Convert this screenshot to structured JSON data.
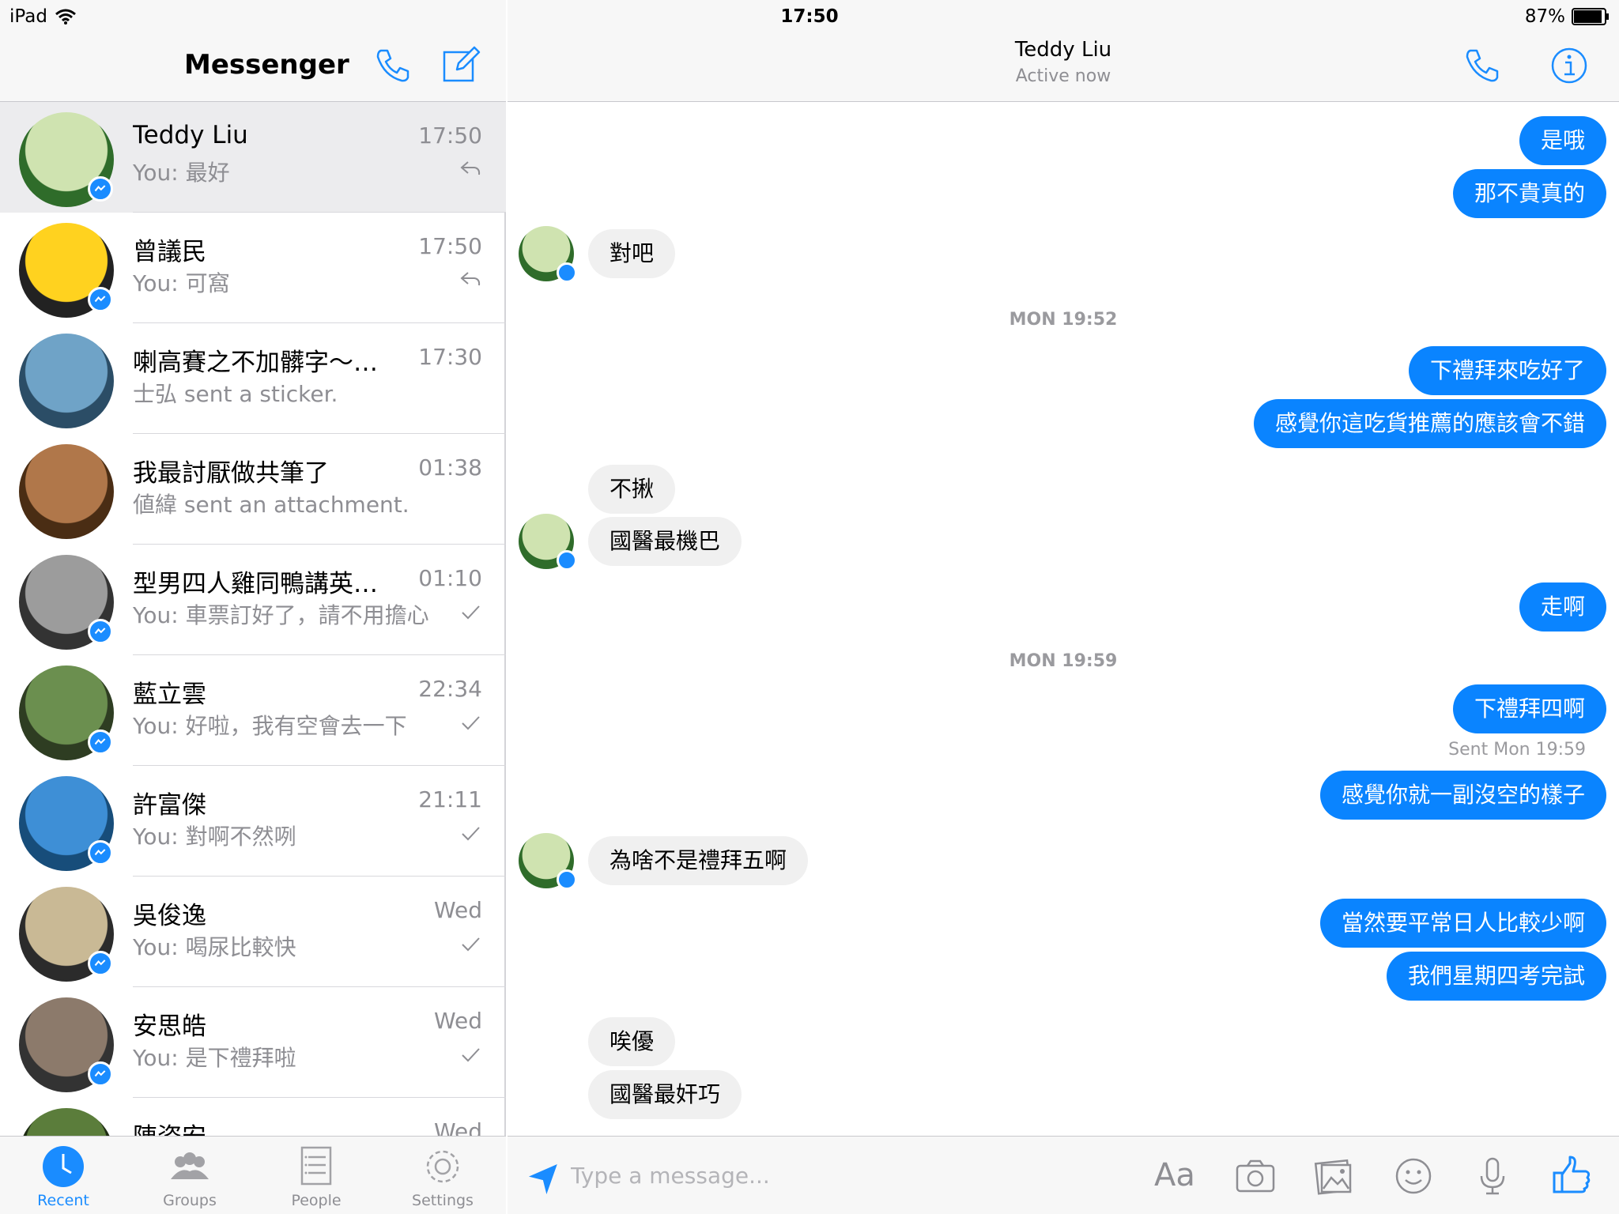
{
  "status_bar": {
    "device": "iPad",
    "time": "17:50",
    "battery": "87%"
  },
  "left_header": {
    "title": "Messenger"
  },
  "conversations": [
    {
      "name": "Teddy Liu",
      "time": "17:50",
      "preview": "You: 最好",
      "status": "reply"
    },
    {
      "name": "曾議民",
      "time": "17:50",
      "preview": "You: 可窩",
      "status": "reply"
    },
    {
      "name": "喇高賽之不加髒字～…",
      "time": "17:30",
      "preview": "士弘 sent a sticker.",
      "status": ""
    },
    {
      "name": "我最討厭做共筆了",
      "time": "01:38",
      "preview": "値緯 sent an attachment.",
      "status": ""
    },
    {
      "name": "型男四人雞同鴨講英…",
      "time": "01:10",
      "preview": "You: 車票訂好了，請不用擔心",
      "status": "check"
    },
    {
      "name": "藍立雲",
      "time": "22:34",
      "preview": "You: 好啦，我有空會去一下",
      "status": "check"
    },
    {
      "name": "許富傑",
      "time": "21:11",
      "preview": "You: 對啊不然咧",
      "status": "check"
    },
    {
      "name": "吳俊逸",
      "time": "Wed",
      "preview": "You: 喝尿比較快",
      "status": "check"
    },
    {
      "name": "安思皓",
      "time": "Wed",
      "preview": "You: 是下禮拜啦",
      "status": "check"
    },
    {
      "name": "陳姿安",
      "time": "Wed",
      "preview": "",
      "status": ""
    }
  ],
  "tabs": [
    {
      "label": "Recent",
      "icon": "clock-icon",
      "active": true
    },
    {
      "label": "Groups",
      "icon": "groups-icon",
      "active": false
    },
    {
      "label": "People",
      "icon": "people-list-icon",
      "active": false
    },
    {
      "label": "Settings",
      "icon": "gear-icon",
      "active": false
    }
  ],
  "chat_header": {
    "name": "Teddy Liu",
    "subtitle": "Active now"
  },
  "messages": [
    {
      "dir": "out",
      "text": "是哦"
    },
    {
      "dir": "out",
      "text": "那不貴真的"
    },
    {
      "dir": "in",
      "text": "對吧"
    },
    {
      "type": "stamp",
      "text": "MON 19:52"
    },
    {
      "dir": "out",
      "text": "下禮拜來吃好了"
    },
    {
      "dir": "out",
      "text": "感覺你這吃貨推薦的應該會不錯"
    },
    {
      "dir": "in",
      "text": "不揪"
    },
    {
      "dir": "in",
      "text": "國醫最機巴"
    },
    {
      "dir": "out",
      "text": "走啊"
    },
    {
      "type": "stamp",
      "text": "MON 19:59"
    },
    {
      "dir": "out",
      "text": "下禮拜四啊"
    },
    {
      "type": "sent",
      "text": "Sent Mon 19:59"
    },
    {
      "dir": "out",
      "text": "感覺你就一副沒空的樣子"
    },
    {
      "dir": "in",
      "text": "為啥不是禮拜五啊"
    },
    {
      "dir": "out",
      "text": "當然要平常日人比較少啊"
    },
    {
      "dir": "out",
      "text": "我們星期四考完試"
    },
    {
      "dir": "in",
      "text": "唉優"
    },
    {
      "dir": "in",
      "text": "國醫最奸巧"
    }
  ],
  "composer": {
    "placeholder": "Type a message...",
    "text_format_label": "Aa",
    "icons": [
      "location-arrow-icon",
      "camera-icon",
      "photo-icon",
      "emoji-icon",
      "microphone-icon",
      "thumbs-up-icon"
    ]
  },
  "colors": {
    "accent": "#1a8cff",
    "bubble_out": "#0a84ff",
    "bubble_in": "#f0f0f0"
  }
}
